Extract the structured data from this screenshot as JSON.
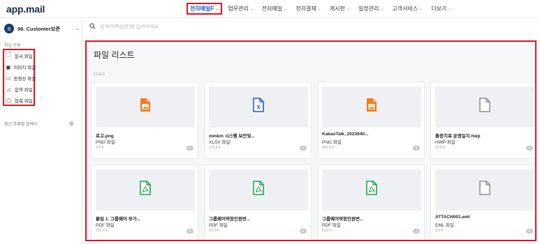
{
  "app": {
    "logo": "app.mail"
  },
  "nav": [
    {
      "label": "전자메일F",
      "active": true
    },
    {
      "label": "업무관리",
      "active": false
    },
    {
      "label": "전자메일",
      "active": false
    },
    {
      "label": "전자결재",
      "active": false
    },
    {
      "label": "게시판",
      "active": false
    },
    {
      "label": "일정관리",
      "active": false
    },
    {
      "label": "고객서비스",
      "active": false
    },
    {
      "label": "더보기",
      "active": false
    }
  ],
  "sidebar": {
    "account": {
      "avatar_text": "회",
      "name": "98. Customer보존"
    },
    "section_label": "파일 분류",
    "categories": [
      {
        "label": "문서 파일",
        "icon": "document-icon"
      },
      {
        "label": "이미지 파일",
        "icon": "image-icon"
      },
      {
        "label": "동영상 파일",
        "icon": "video-icon"
      },
      {
        "label": "음악 파일",
        "icon": "music-icon"
      },
      {
        "label": "압축 파일",
        "icon": "archive-icon"
      }
    ],
    "recent_label": "최근 주제별 컬렉터"
  },
  "search": {
    "placeholder": "검색어(파일명)를 입력하세요"
  },
  "main": {
    "title": "파일 리스트",
    "files_label": "FILES"
  },
  "files": [
    {
      "name": "로고.png",
      "type": "PNG 파일",
      "size": "3.1 K",
      "count": "1",
      "icon": "image-file-icon",
      "color": "#f07c1e"
    },
    {
      "name": "mmkm 시스템 보안및...",
      "type": "XLSX 파일",
      "size": "176.8 K",
      "count": "2",
      "icon": "excel-file-icon",
      "color": "#1e5bd6"
    },
    {
      "name": "KakaoTalk_2023040...",
      "type": "PNG 파일",
      "size": "462.6 K",
      "count": "3",
      "icon": "image-file-icon",
      "color": "#f07c1e"
    },
    {
      "name": "통증치료 운영일지.hwp",
      "type": "HWP 파일",
      "size": "22.8 K",
      "count": "4",
      "icon": "generic-file-icon",
      "color": "#8a8f98"
    },
    {
      "name": "붙임 1. 그룹웨어 부가...",
      "type": "PDF 파일",
      "size": "731.0 K",
      "count": "5",
      "icon": "pdf-file-icon",
      "color": "#1ea34a"
    },
    {
      "name": "그룹웨어약정인원변...",
      "type": "PDF 파일",
      "size": "81.5 K",
      "count": "6",
      "icon": "pdf-file-icon",
      "color": "#1ea34a"
    },
    {
      "name": "그룹웨어약정인원변...",
      "type": "PDF 파일",
      "size": "81.5 K",
      "count": "7",
      "icon": "pdf-file-icon",
      "color": "#1ea34a"
    },
    {
      "name": "ATTACH001.eml",
      "type": "EML 파일",
      "size": "3.9 K",
      "count": "8",
      "icon": "generic-file-icon",
      "color": "#8a8f98"
    }
  ]
}
